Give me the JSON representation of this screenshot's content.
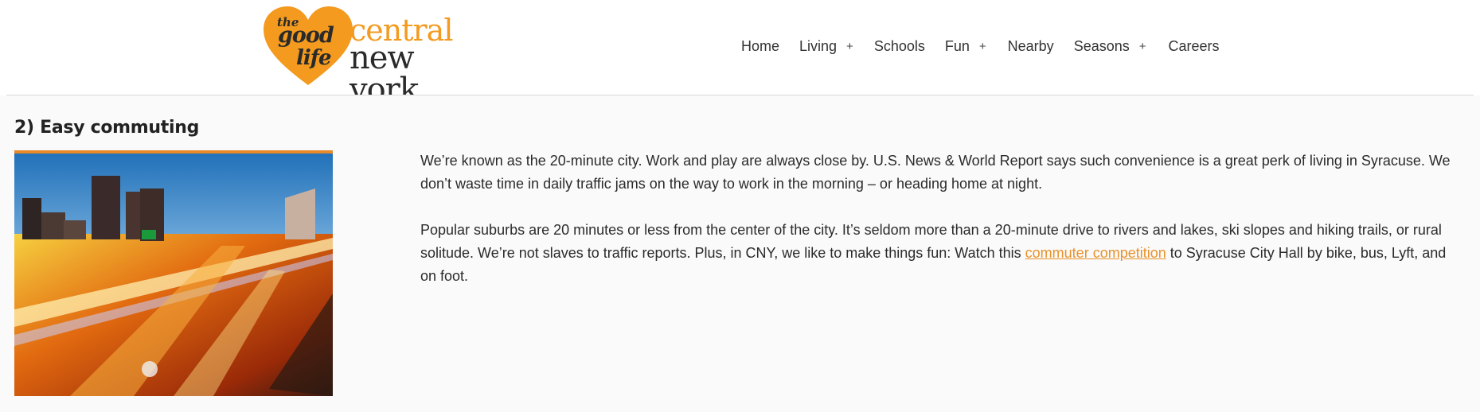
{
  "brand": {
    "the": "the",
    "good": "good",
    "life": "life",
    "central": "central",
    "new_york": "new york",
    "heart_color": "#f39a1f"
  },
  "nav": {
    "items": [
      {
        "label": "Home",
        "has_submenu": false
      },
      {
        "label": "Living",
        "has_submenu": true
      },
      {
        "label": "Schools",
        "has_submenu": false
      },
      {
        "label": "Fun",
        "has_submenu": true
      },
      {
        "label": "Nearby",
        "has_submenu": false
      },
      {
        "label": "Seasons",
        "has_submenu": true
      },
      {
        "label": "Careers",
        "has_submenu": false
      }
    ],
    "submenu_glyph": "+"
  },
  "section": {
    "title": "2) Easy commuting",
    "photo_icon": "city-highway-night-photo",
    "paragraph1": "We’re known as the 20-minute city. Work and play are always close by. U.S. News & World Report says such convenience is a great perk of living in Syracuse. We don’t waste time in daily traffic jams on the way to work in the morning – or heading home at night.",
    "paragraph2_before": "Popular suburbs are 20 minutes or less from the center of the city. It’s seldom more than a 20-minute drive to rivers and lakes, ski slopes and hiking trails, or rural solitude. We’re not slaves to traffic reports. Plus, in CNY, we like to make things fun: Watch this ",
    "paragraph2_link": "commuter competition",
    "paragraph2_after": " to Syracuse City Hall by bike, bus, Lyft, and on foot.",
    "link_color": "#e8922a"
  }
}
